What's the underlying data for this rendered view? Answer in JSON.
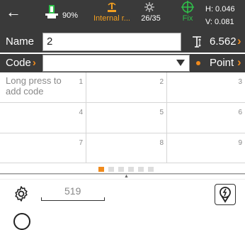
{
  "statusbar": {
    "battery_percent": "90%",
    "radio_label": "Internal r...",
    "satellites": "26/35",
    "fix_label": "Fix",
    "h_value": "H: 0.046",
    "v_value": "V: 0.081"
  },
  "form": {
    "name_label": "Name",
    "name_value": "2",
    "antenna_height": "6.562",
    "code_label": "Code",
    "code_value": "",
    "point_label": "Point"
  },
  "grid": {
    "cells": [
      {
        "num": "1",
        "text": "Long press to add code"
      },
      {
        "num": "2",
        "text": ""
      },
      {
        "num": "3",
        "text": ""
      },
      {
        "num": "4",
        "text": ""
      },
      {
        "num": "5",
        "text": ""
      },
      {
        "num": "6",
        "text": ""
      },
      {
        "num": "7",
        "text": ""
      },
      {
        "num": "8",
        "text": ""
      },
      {
        "num": "9",
        "text": ""
      }
    ]
  },
  "pager": {
    "page_count": 6,
    "current_page": 1
  },
  "bottom": {
    "point_id": "519"
  },
  "colors": {
    "accent": "#f08a1c",
    "fix_green": "#2fbf4a",
    "header_bg": "#3a3a3a"
  }
}
